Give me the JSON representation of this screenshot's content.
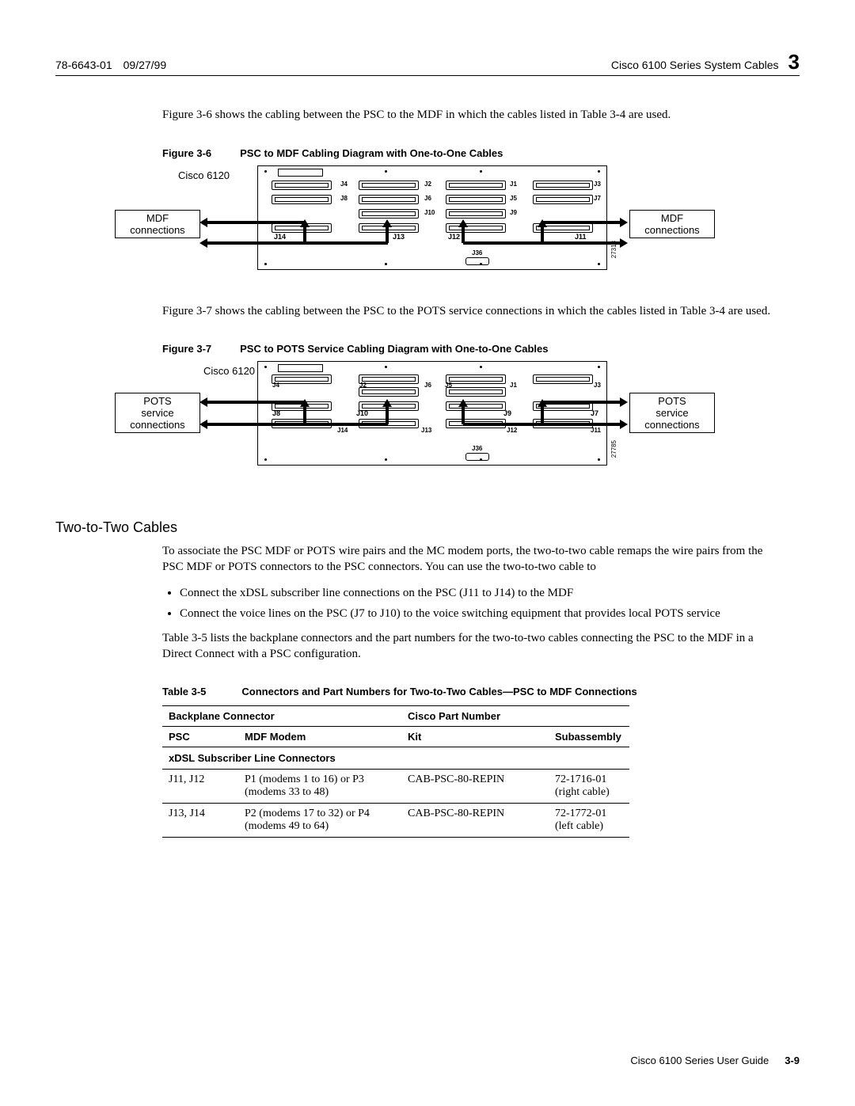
{
  "header": {
    "doc_id": "78-6643-01",
    "date": "09/27/99",
    "title": "Cisco 6100 Series System Cables",
    "chapter_number": "3"
  },
  "intro_para_1": "Figure 3-6 shows the cabling between the PSC to the MDF in which the cables listed in Table 3-4 are used.",
  "figure_3_6": {
    "label": "Figure 3-6",
    "title": "PSC to MDF Cabling Diagram with One-to-One Cables",
    "device": "Cisco 6120",
    "left_box": "MDF connections",
    "right_box": "MDF connections",
    "id_side": "27318",
    "j_small": "J36",
    "j_top": [
      "J4",
      "J2",
      "J1",
      "J3"
    ],
    "j_mid": [
      "J8",
      "J6",
      "J5",
      "J7"
    ],
    "j_mid2": [
      "J10",
      "J9"
    ],
    "j_bold": [
      "J14",
      "J13",
      "J12",
      "J11"
    ]
  },
  "intro_para_2": "Figure 3-7 shows the cabling between the PSC to the POTS service connections in which the cables listed in Table 3-4 are used.",
  "figure_3_7": {
    "label": "Figure 3-7",
    "title": "PSC to POTS Service Cabling Diagram with One-to-One Cables",
    "device": "Cisco 6120",
    "left_box": "POTS service connections",
    "right_box": "POTS service connections",
    "id_side": "27785",
    "j_small": "J36",
    "j_top": [
      "J4",
      "J2",
      "J1",
      "J3"
    ],
    "j_mid": [
      "J6",
      "J5"
    ],
    "j_bold": [
      "J8",
      "J10",
      "J9",
      "J7"
    ],
    "j_bot": [
      "J14",
      "J13",
      "J12",
      "J11"
    ]
  },
  "section": {
    "title": "Two-to-Two Cables",
    "para1": "To associate the PSC MDF or POTS wire pairs and the MC modem ports, the two-to-two cable remaps the wire pairs from the PSC MDF or POTS connectors to the PSC connectors. You can use the two-to-two cable to",
    "bullet1": "Connect the xDSL subscriber line connections on the PSC (J11 to J14) to the MDF",
    "bullet2": "Connect the voice lines on the PSC (J7 to J10) to the voice switching equipment that provides local POTS service",
    "para2": "Table 3-5 lists the backplane connectors and the part numbers for the two-to-two cables connecting the PSC to the MDF in a Direct Connect with a PSC configuration."
  },
  "table_3_5": {
    "label": "Table 3-5",
    "title": "Connectors and Part Numbers for Two-to-Two Cables—PSC to MDF Connections",
    "h_backplane": "Backplane Connector",
    "h_part": "Cisco Part Number",
    "h_psc": "PSC",
    "h_modem": "MDF Modem",
    "h_kit": "Kit",
    "h_sub": "Subassembly",
    "section1": "xDSL Subscriber Line Connectors",
    "rows": [
      {
        "psc": "J11, J12",
        "modem": "P1 (modems 1 to 16) or P3 (modems 33 to 48)",
        "kit": "CAB-PSC-80-REPIN",
        "sub": "72-1716-01 (right cable)"
      },
      {
        "psc": "J13, J14",
        "modem": "P2 (modems 17 to 32) or P4 (modems 49 to 64)",
        "kit": "CAB-PSC-80-REPIN",
        "sub": "72-1772-01 (left cable)"
      }
    ]
  },
  "footer": {
    "title": "Cisco 6100 Series User Guide",
    "page": "3-9"
  }
}
